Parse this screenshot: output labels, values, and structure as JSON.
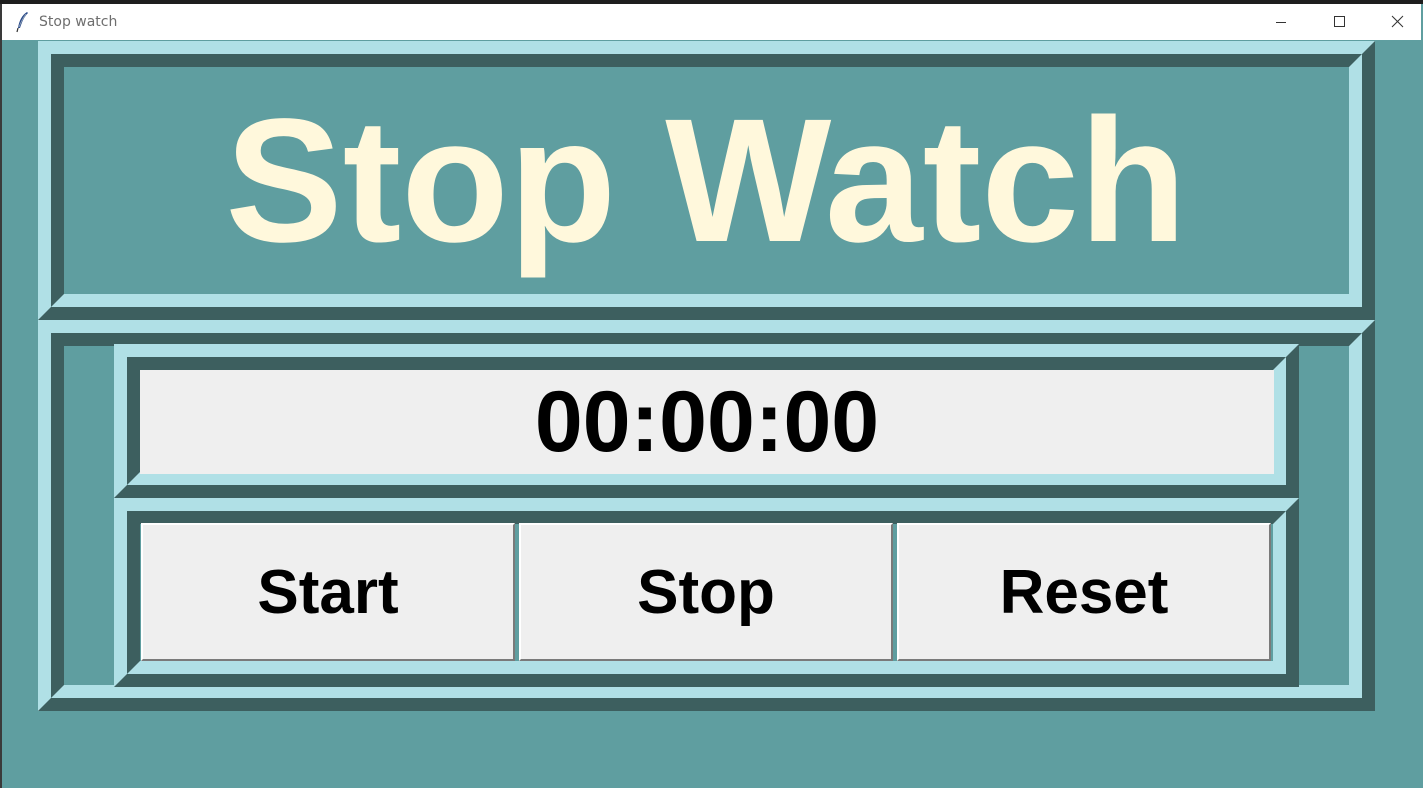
{
  "window": {
    "title": "Stop watch",
    "controls": {
      "minimize": "minimize-icon",
      "maximize": "maximize-icon",
      "close": "close-icon"
    }
  },
  "app": {
    "heading": "Stop Watch",
    "time": "00:00:00"
  },
  "buttons": {
    "start": "Start",
    "stop": "Stop",
    "reset": "Reset"
  },
  "colors": {
    "background": "#5f9ea0",
    "heading_text": "#fff8dc",
    "ridge_light": "#b0e0e6",
    "ridge_dark": "#3d5f5f",
    "display_bg": "#efefef"
  }
}
